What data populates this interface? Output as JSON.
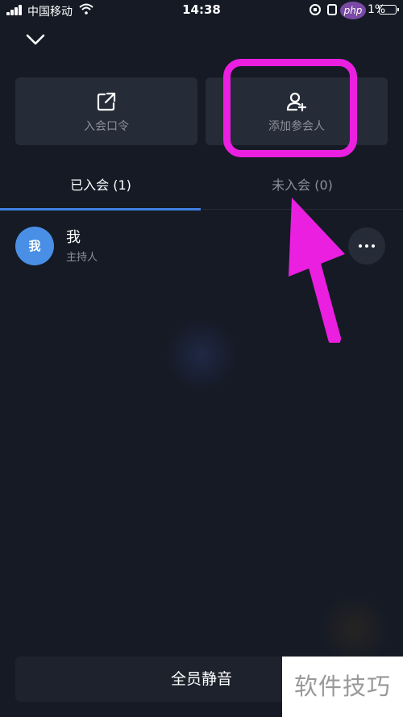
{
  "status_bar": {
    "carrier": "中国移动",
    "time": "14:38",
    "php_badge": "php",
    "battery_percent": "1%"
  },
  "header": {
    "collapse_icon": "chevron-down-icon"
  },
  "actions": [
    {
      "icon": "share-external-icon",
      "label": "入会口令"
    },
    {
      "icon": "add-person-icon",
      "label": "添加参会人"
    }
  ],
  "tabs": {
    "joined": "已入会 (1)",
    "not_joined": "未入会 (0)",
    "active": "joined"
  },
  "participants": [
    {
      "avatar_text": "我",
      "name": "我",
      "role": "主持人"
    }
  ],
  "bottom": {
    "mute_all": "全员静音"
  },
  "watermark": "软件技巧",
  "colors": {
    "background": "#151a25",
    "card": "#252b37",
    "accent": "#3f7fe0",
    "avatar": "#4a8fe6",
    "annotation": "#ea1fe0"
  }
}
